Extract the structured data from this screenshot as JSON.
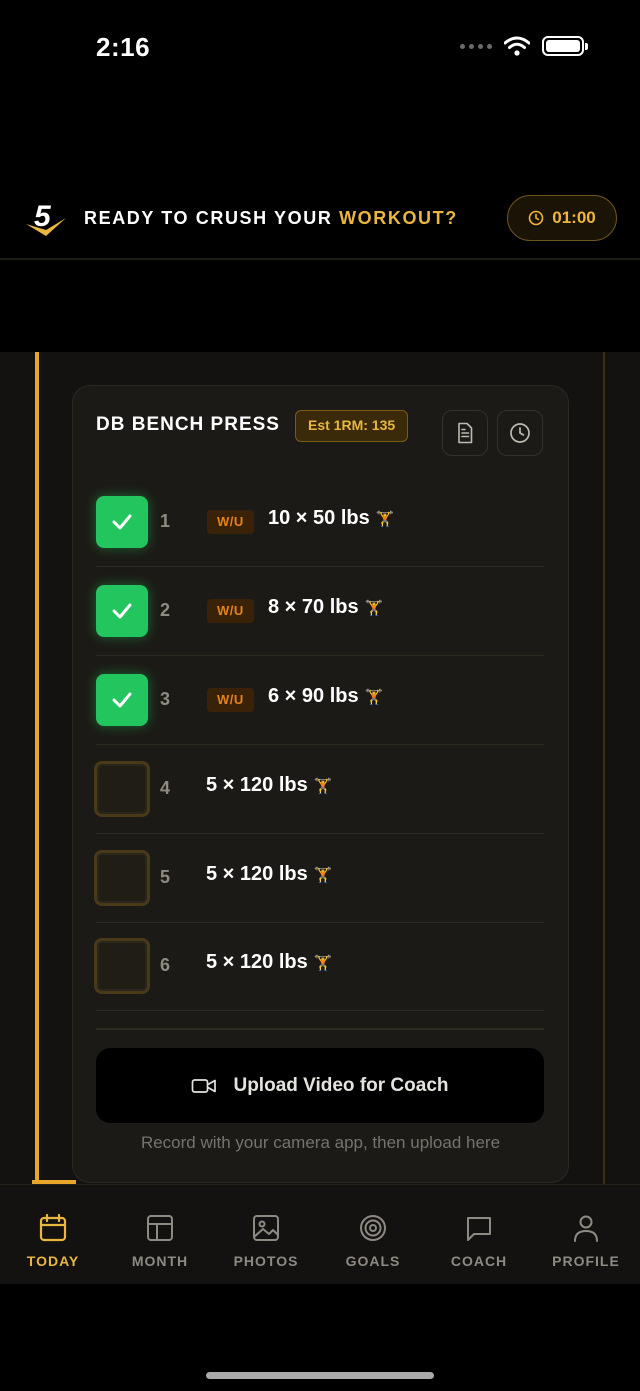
{
  "status": {
    "time": "2:16"
  },
  "header": {
    "logo_text": "5",
    "title_white": "READY TO CRUSH YOUR",
    "title_gold": "WORKOUT?",
    "timer": "01:00"
  },
  "exercise": {
    "name": "DB BENCH PRESS",
    "est_1rm": "Est 1RM: 135",
    "sets": [
      {
        "num": "1",
        "warmup": "W/U",
        "value": "10 × 50 lbs",
        "done": true
      },
      {
        "num": "2",
        "warmup": "W/U",
        "value": "8 × 70 lbs",
        "done": true
      },
      {
        "num": "3",
        "warmup": "W/U",
        "value": "6 × 90 lbs",
        "done": true
      },
      {
        "num": "4",
        "warmup": "",
        "value": "5 × 120 lbs",
        "done": false
      },
      {
        "num": "5",
        "warmup": "",
        "value": "5 × 120 lbs",
        "done": false
      },
      {
        "num": "6",
        "warmup": "",
        "value": "5 × 120 lbs",
        "done": false
      }
    ],
    "set_icon": "🏋",
    "upload_label": "Upload Video for Coach",
    "upload_hint": "Record with your camera app, then upload here"
  },
  "tabs": [
    {
      "label": "TODAY",
      "icon": "calendar-icon",
      "active": true
    },
    {
      "label": "MONTH",
      "icon": "grid-icon",
      "active": false
    },
    {
      "label": "PHOTOS",
      "icon": "image-icon",
      "active": false
    },
    {
      "label": "GOALS",
      "icon": "target-icon",
      "active": false
    },
    {
      "label": "COACH",
      "icon": "chat-icon",
      "active": false
    },
    {
      "label": "PROFILE",
      "icon": "person-icon",
      "active": false
    }
  ],
  "colors": {
    "accent": "#e9b640",
    "success": "#22c55e",
    "warmup": "#e7821b"
  }
}
